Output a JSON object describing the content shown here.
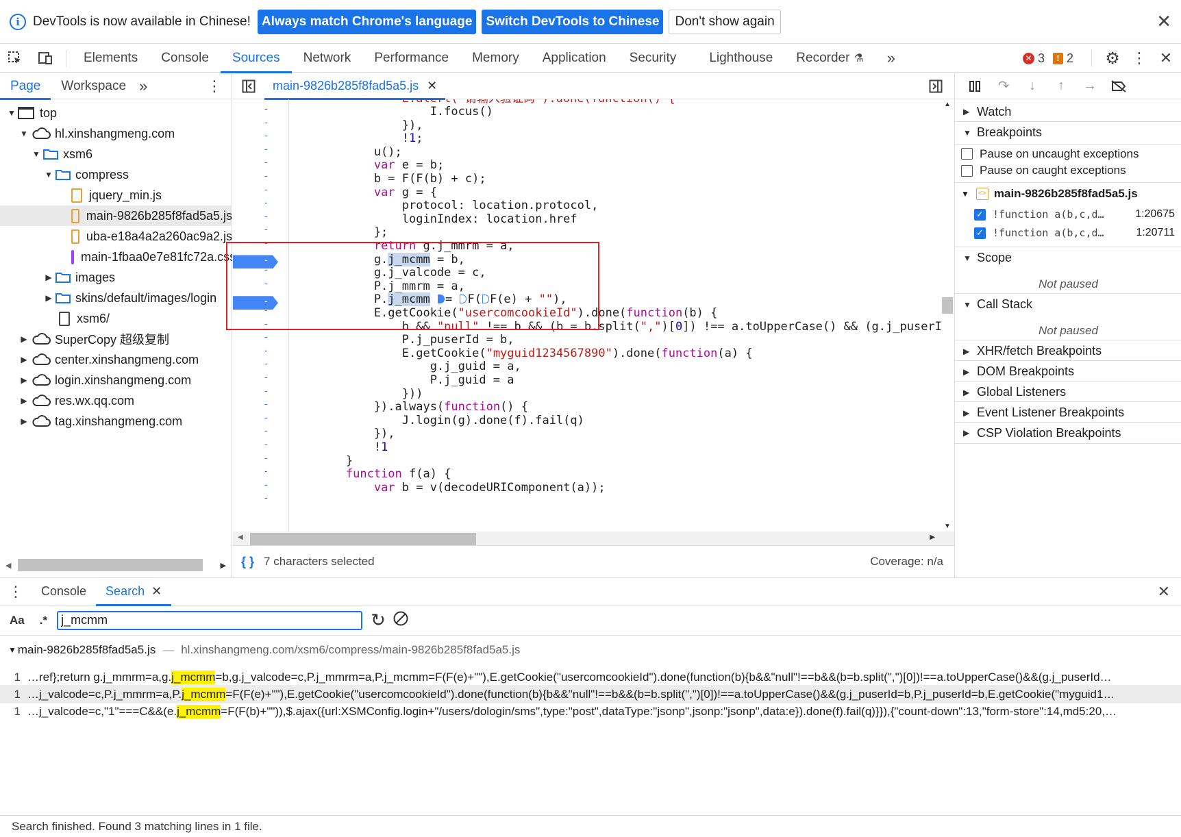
{
  "infobar": {
    "message": "DevTools is now available in Chinese!",
    "btn_match": "Always match Chrome's language",
    "btn_switch": "Switch DevTools to Chinese",
    "btn_dismiss": "Don't show again"
  },
  "main_tabs": [
    "Elements",
    "Console",
    "Sources",
    "Network",
    "Performance",
    "Memory",
    "Application",
    "Security",
    "Lighthouse",
    "Recorder"
  ],
  "active_main_tab": "Sources",
  "counts": {
    "errors": "3",
    "warnings": "2"
  },
  "navigator": {
    "tabs": [
      "Page",
      "Workspace"
    ],
    "tree": {
      "top": "top",
      "host1": "hl.xinshangmeng.com",
      "xsm6": "xsm6",
      "compress": "compress",
      "file1": "jquery_min.js",
      "file2": "main-9826b285f8fad5a5.js",
      "file3": "uba-e18a4a2a260ac9a2.js",
      "file4": "main-1fbaa0e7e81fc72a.css",
      "images": "images",
      "skins": "skins/default/images/login",
      "xsm6doc": "xsm6/",
      "supercopy": "SuperCopy 超级复制",
      "host2": "center.xinshangmeng.com",
      "host3": "login.xinshangmeng.com",
      "host4": "res.wx.qq.com",
      "host5": "tag.xinshangmeng.com"
    }
  },
  "editor": {
    "open_file": "main-9826b285f8fad5a5.js",
    "status_left": "7 characters selected",
    "status_right": "Coverage: n/a"
  },
  "debugger": {
    "watch": "Watch",
    "breakpoints": "Breakpoints",
    "pause_uncaught": "Pause on uncaught exceptions",
    "pause_caught": "Pause on caught exceptions",
    "bp_file": "main-9826b285f8fad5a5.js",
    "bp1_code": "!function a(b,c,d…",
    "bp1_loc": "1:20675",
    "bp2_code": "!function a(b,c,d…",
    "bp2_loc": "1:20711",
    "scope": "Scope",
    "scope_state": "Not paused",
    "callstack": "Call Stack",
    "callstack_state": "Not paused",
    "xhr": "XHR/fetch Breakpoints",
    "dom": "DOM Breakpoints",
    "global": "Global Listeners",
    "event": "Event Listener Breakpoints",
    "csp": "CSP Violation Breakpoints"
  },
  "drawer": {
    "tabs": [
      "Console",
      "Search"
    ],
    "case_label": "Aa",
    "regex_label": ".*",
    "query": "j_mcmm",
    "result_file": "main-9826b285f8fad5a5.js",
    "result_path": "hl.xinshangmeng.com/xsm6/compress/main-9826b285f8fad5a5.js",
    "results": [
      {
        "line": "1",
        "before": "…ref};return g.j_mmrm=a,g.",
        "match": "j_mcmm",
        "after": "=b,g.j_valcode=c,P.j_mmrm=a,P.j_mcmm=F(F(e)+\"\"),E.getCookie(\"usercomcookieId\").done(function(b){b&&\"null\"!==b&&(b=b.split(\",\")[0])!==a.toUpperCase()&&(g.j_puserId…"
      },
      {
        "line": "1",
        "before": "…j_valcode=c,P.j_mmrm=a,P.",
        "match": "j_mcmm",
        "after": "=F(F(e)+\"\"),E.getCookie(\"usercomcookieId\").done(function(b){b&&\"null\"!==b&&(b=b.split(\",\")[0])!==a.toUpperCase()&&(g.j_puserId=b,P.j_puserId=b,E.getCookie(\"myguid1…"
      },
      {
        "line": "1",
        "before": "…j_valcode=c,\"1\"===C&&(e.",
        "match": "j_mcmm",
        "after": "=F(F(b)+\"\")),$.ajax({url:XSMConfig.login+\"/users/dologin/sms\",type:\"post\",dataType:\"jsonp\",jsonp:\"jsonp\",data:e}).done(f).fail(q)}}),{\"count-down\":13,\"form-store\":14,md5:20,…"
      }
    ],
    "status": "Search finished.  Found 3 matching lines in 1 file."
  }
}
